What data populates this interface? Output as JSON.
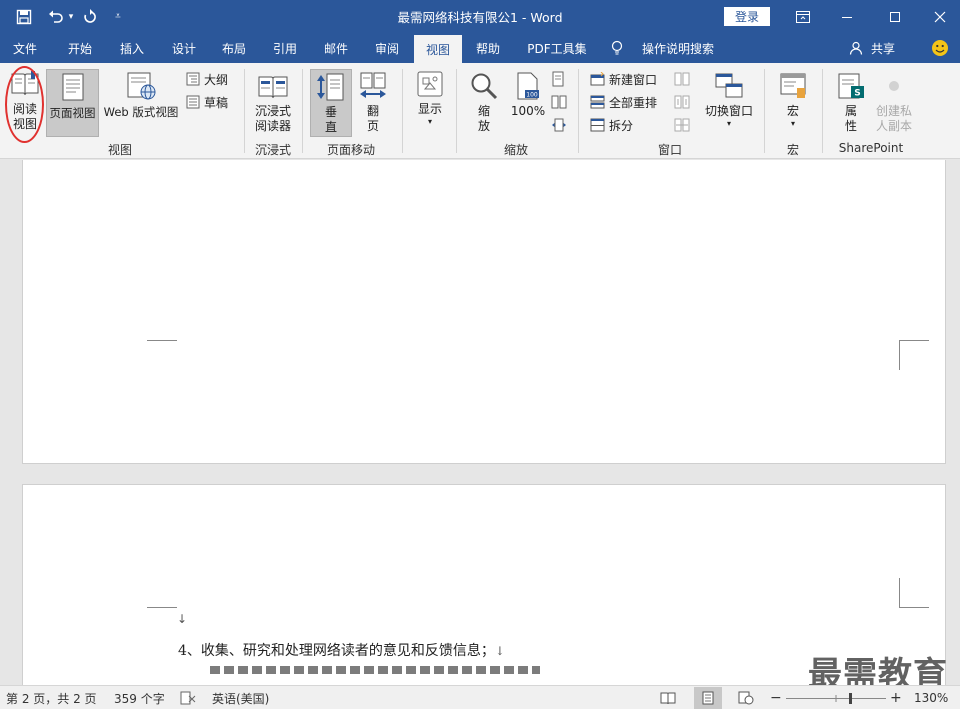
{
  "titlebar": {
    "title": "最需网络科技有限公1  -  Word",
    "login": "登录"
  },
  "tabs": [
    "文件",
    "开始",
    "插入",
    "设计",
    "布局",
    "引用",
    "邮件",
    "审阅",
    "视图",
    "帮助",
    "PDF工具集",
    "操作说明搜索"
  ],
  "active_tab": "视图",
  "share": "共享",
  "ribbon": {
    "view_group": {
      "label": "视图",
      "read_mode": "阅读\n视图",
      "print_layout": "页面视图",
      "web_layout": "Web 版式视图",
      "outline": "大纲",
      "draft": "草稿"
    },
    "immersive_group": {
      "label": "沉浸式",
      "immersive_reader": "沉浸式\n阅读器"
    },
    "page_movement_group": {
      "label": "页面移动",
      "vertical": "垂\n直",
      "side_to_side": "翻\n页"
    },
    "show_group": {
      "show": "显示"
    },
    "zoom_group": {
      "label": "缩放",
      "zoom": "缩\n放",
      "hundred": "100%"
    },
    "window_group": {
      "label": "窗口",
      "new_window": "新建窗口",
      "arrange_all": "全部重排",
      "split": "拆分",
      "switch_windows": "切换窗口"
    },
    "macros_group": {
      "label": "宏",
      "macros": "宏"
    },
    "sharepoint_group": {
      "label": "SharePoint",
      "properties": "属\n性",
      "private_copy": "创建私\n人副本"
    }
  },
  "document": {
    "line1": "4、收集、研究和处理网络读者的意见和反馈信息；",
    "return_mark": "↓"
  },
  "statusbar": {
    "page": "第 2 页，共 2 页",
    "words": "359 个字",
    "language": "英语(美国)",
    "zoom_minus": "−",
    "zoom_plus": "+",
    "zoom": "130%"
  },
  "zoom_level": 0.65,
  "watermark": "最需教育",
  "colors": {
    "brand": "#2b579a",
    "highlight_circle": "#e0312f"
  }
}
